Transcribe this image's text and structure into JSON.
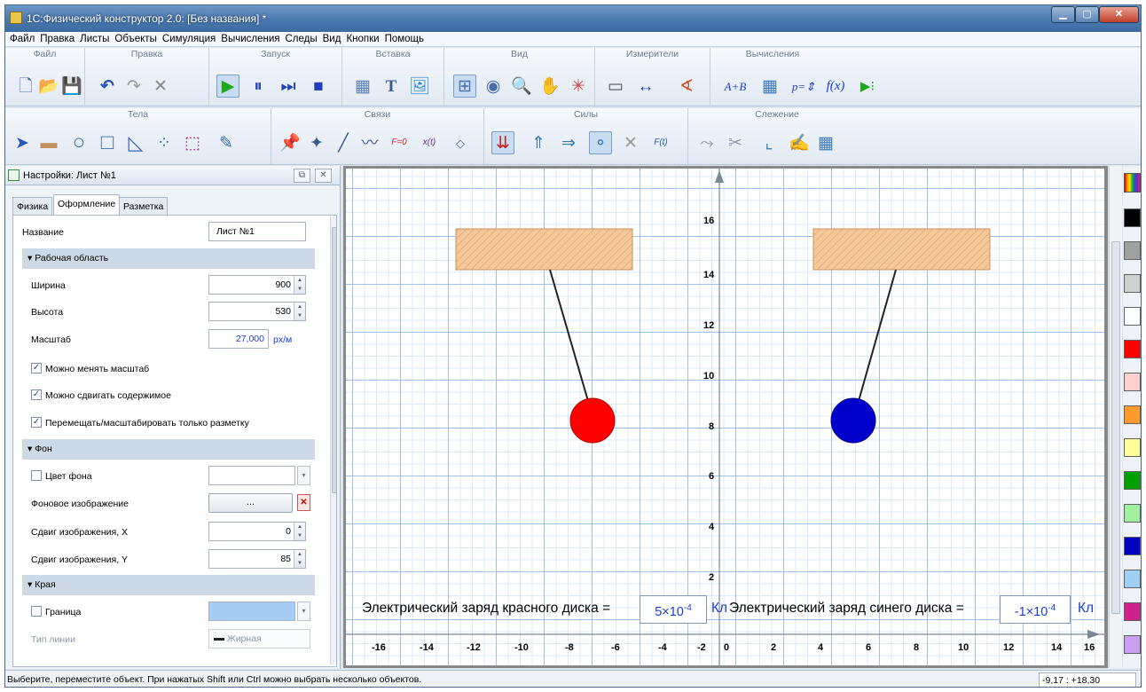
{
  "window": {
    "title": "1С:Физический конструктор 2.0: [Без названия] *"
  },
  "menu": [
    "Файл",
    "Правка",
    "Листы",
    "Объекты",
    "Симуляция",
    "Вычисления",
    "Следы",
    "Вид",
    "Кнопки",
    "Помощь"
  ],
  "toolbar1": {
    "groups": {
      "file": "Файл",
      "edit": "Правка",
      "run": "Запуск",
      "insert": "Вставка",
      "view": "Вид",
      "meters": "Измерители",
      "calc": "Вычисления"
    }
  },
  "toolbar2": {
    "groups": {
      "bodies": "Тела",
      "links": "Связи",
      "forces": "Силы",
      "tracking": "Слежение"
    }
  },
  "panel": {
    "title": "Настройки: Лист №1",
    "tabs": [
      "Физика",
      "Оформление",
      "Разметка"
    ],
    "active_tab": "Оформление",
    "name_label": "Название",
    "name_value": "Лист №1",
    "section_workspace": "Рабочая область",
    "width_label": "Ширина",
    "width_value": "900",
    "height_label": "Высота",
    "height_value": "530",
    "scale_label": "Масштаб",
    "scale_value": "27,000",
    "scale_unit": "px/м",
    "chk_scale": "Можно менять масштаб",
    "chk_move": "Можно сдвигать содержимое",
    "chk_markup": "Перемещать/масштабировать только разметку",
    "section_bg": "Фон",
    "bg_color_label": "Цвет фона",
    "bg_image_label": "Фоновое изображение",
    "bg_image_button": "...",
    "offset_x_label": "Сдвиг изображения, X",
    "offset_x_value": "0",
    "offset_y_label": "Сдвиг изображения, Y",
    "offset_y_value": "85",
    "section_edges": "Края",
    "border_label": "Граница",
    "line_type_label": "Тип линии",
    "line_type_value": "Жирная"
  },
  "canvas": {
    "y_labels": [
      "16",
      "14",
      "12",
      "10",
      "8",
      "6",
      "4",
      "2"
    ],
    "x_labels": [
      "-16",
      "-14",
      "-12",
      "-10",
      "-8",
      "-6",
      "-4",
      "-2",
      "0",
      "2",
      "4",
      "6",
      "8",
      "10",
      "12",
      "14",
      "16"
    ],
    "red_label": "Электрический заряд красного диска  =",
    "red_value_mantissa": "5×10",
    "red_value_exp": "-4",
    "blue_label": "Электрический заряд синего диска  =",
    "blue_value_mantissa": "-1×10",
    "blue_value_exp": "-4",
    "unit": "Кл",
    "colors": {
      "red_disk": "#ff0000",
      "blue_disk": "#0000cc",
      "ceiling": "#f5c89a"
    }
  },
  "palette": [
    "#000000",
    "#a0a0a0",
    "#d0d0d0",
    "#ffffff",
    "#ff0000",
    "#ffd0d0",
    "#ff9a2e",
    "#ffff99",
    "#00a000",
    "#a0f0a0",
    "#0000c0",
    "#a0cff5",
    "#d0208a",
    "#c9a0f0"
  ],
  "status": {
    "message": "Выберите, переместите объект. При нажатых Shift или Ctrl можно выбрать несколько объектов.",
    "coords": "-9,17 : +18,30"
  }
}
